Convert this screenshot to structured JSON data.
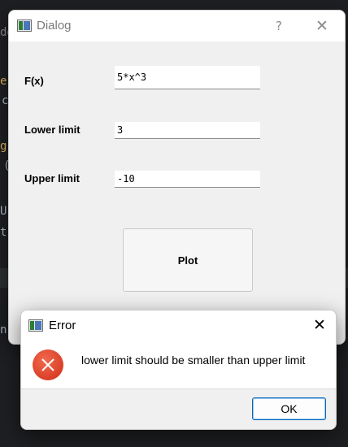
{
  "background_editor": {
    "fragments": [
      "dg",
      "e(",
      "c",
      "g)",
      "(",
      "U",
      "t",
      "n"
    ]
  },
  "dialog": {
    "title": "Dialog",
    "help_button": "?",
    "close_button": "✕",
    "fields": [
      {
        "label": "F(x)",
        "value": "5*x^3"
      },
      {
        "label": "Lower limit",
        "value": "3"
      },
      {
        "label": "Upper limit",
        "value": "-10"
      }
    ],
    "plot_button": "Plot"
  },
  "error_box": {
    "title": "Error",
    "close_button": "✕",
    "icon": "error-circle-icon",
    "message": "lower limit should be smaller than upper limit",
    "ok_button": "OK"
  },
  "colors": {
    "error_icon": "#e0482f",
    "ok_button_border": "#0067c0"
  }
}
